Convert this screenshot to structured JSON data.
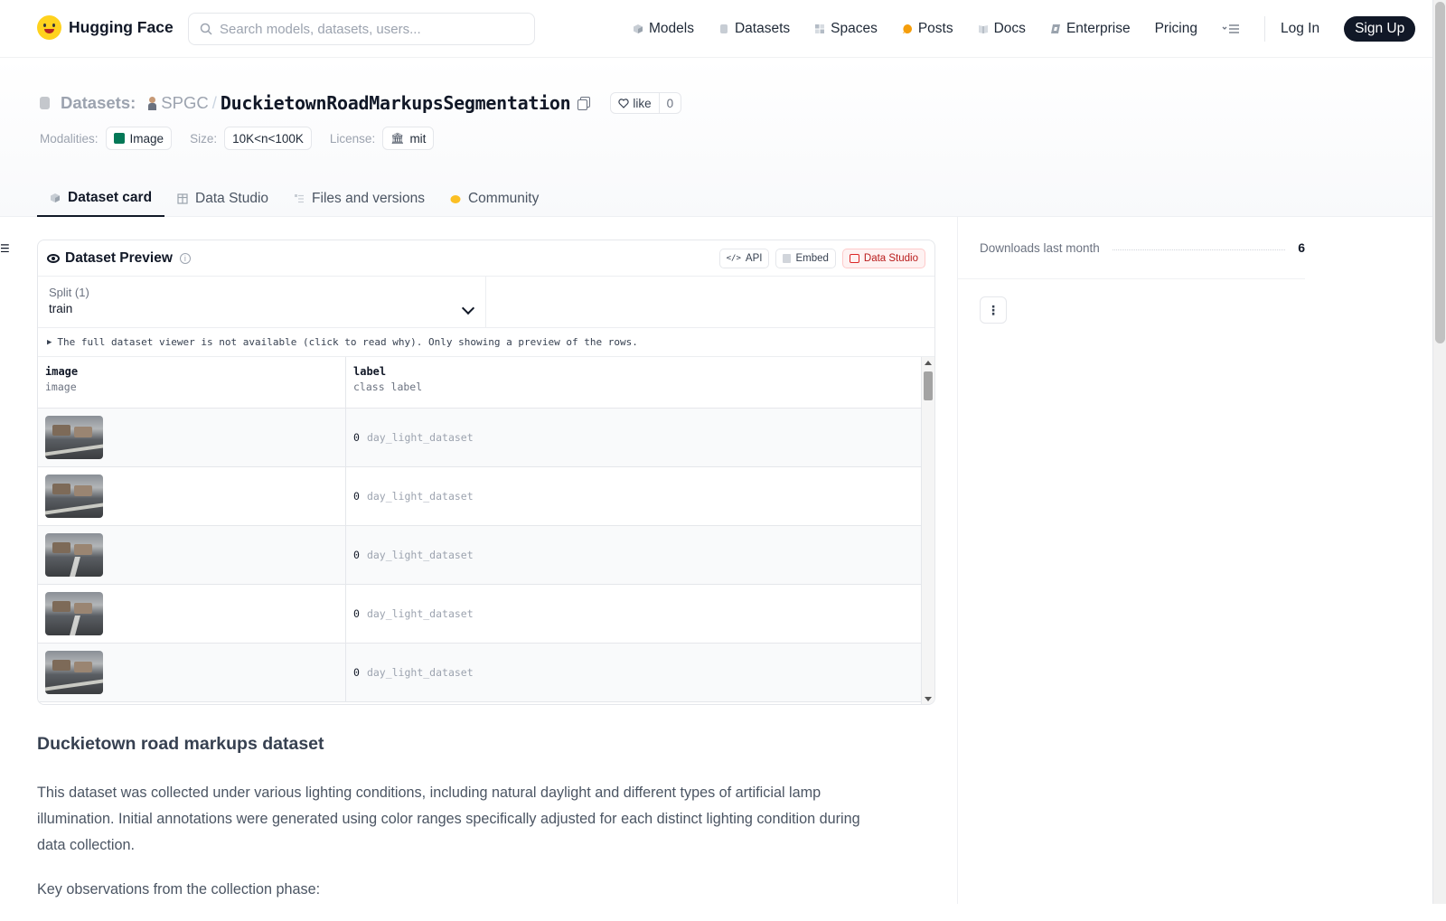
{
  "nav": {
    "brand": "Hugging Face",
    "search_placeholder": "Search models, datasets, users...",
    "links": [
      "Models",
      "Datasets",
      "Spaces",
      "Posts",
      "Docs",
      "Enterprise",
      "Pricing"
    ],
    "login": "Log In",
    "signup": "Sign Up"
  },
  "header": {
    "section": "Datasets:",
    "org": "SPGC",
    "separator": "/",
    "repo": "DuckietownRoadMarkupsSegmentation",
    "like_label": "like",
    "like_count": "0",
    "modalities_label": "Modalities:",
    "modality": "Image",
    "size_label": "Size:",
    "size": "10K<n<100K",
    "license_label": "License:",
    "license": "mit"
  },
  "tabs": [
    "Dataset card",
    "Data Studio",
    "Files and versions",
    "Community"
  ],
  "preview": {
    "title": "Dataset Preview",
    "btn_api": "API",
    "btn_embed": "Embed",
    "btn_studio": "Data Studio",
    "split_label": "Split (1)",
    "split_value": "train",
    "notice": "The full dataset viewer is not available (click to read why). Only showing a preview of the rows.",
    "columns": [
      {
        "name": "image",
        "type": "image"
      },
      {
        "name": "label",
        "type": "class label"
      }
    ],
    "rows": [
      {
        "label_num": "0",
        "label_class": "day_light_dataset"
      },
      {
        "label_num": "0",
        "label_class": "day_light_dataset"
      },
      {
        "label_num": "0",
        "label_class": "day_light_dataset"
      },
      {
        "label_num": "0",
        "label_class": "day_light_dataset"
      },
      {
        "label_num": "0",
        "label_class": "day_light_dataset"
      }
    ]
  },
  "card": {
    "heading": "Duckietown road markups dataset",
    "paragraph1": "This dataset was collected under various lighting conditions, including natural daylight and different types of artificial lamp illumination. Initial annotations were generated using color ranges specifically adjusted for each distinct lighting condition during data collection.",
    "paragraph2": "Key observations from the collection phase:"
  },
  "sidebar": {
    "downloads_label": "Downloads last month",
    "downloads_value": "6"
  }
}
